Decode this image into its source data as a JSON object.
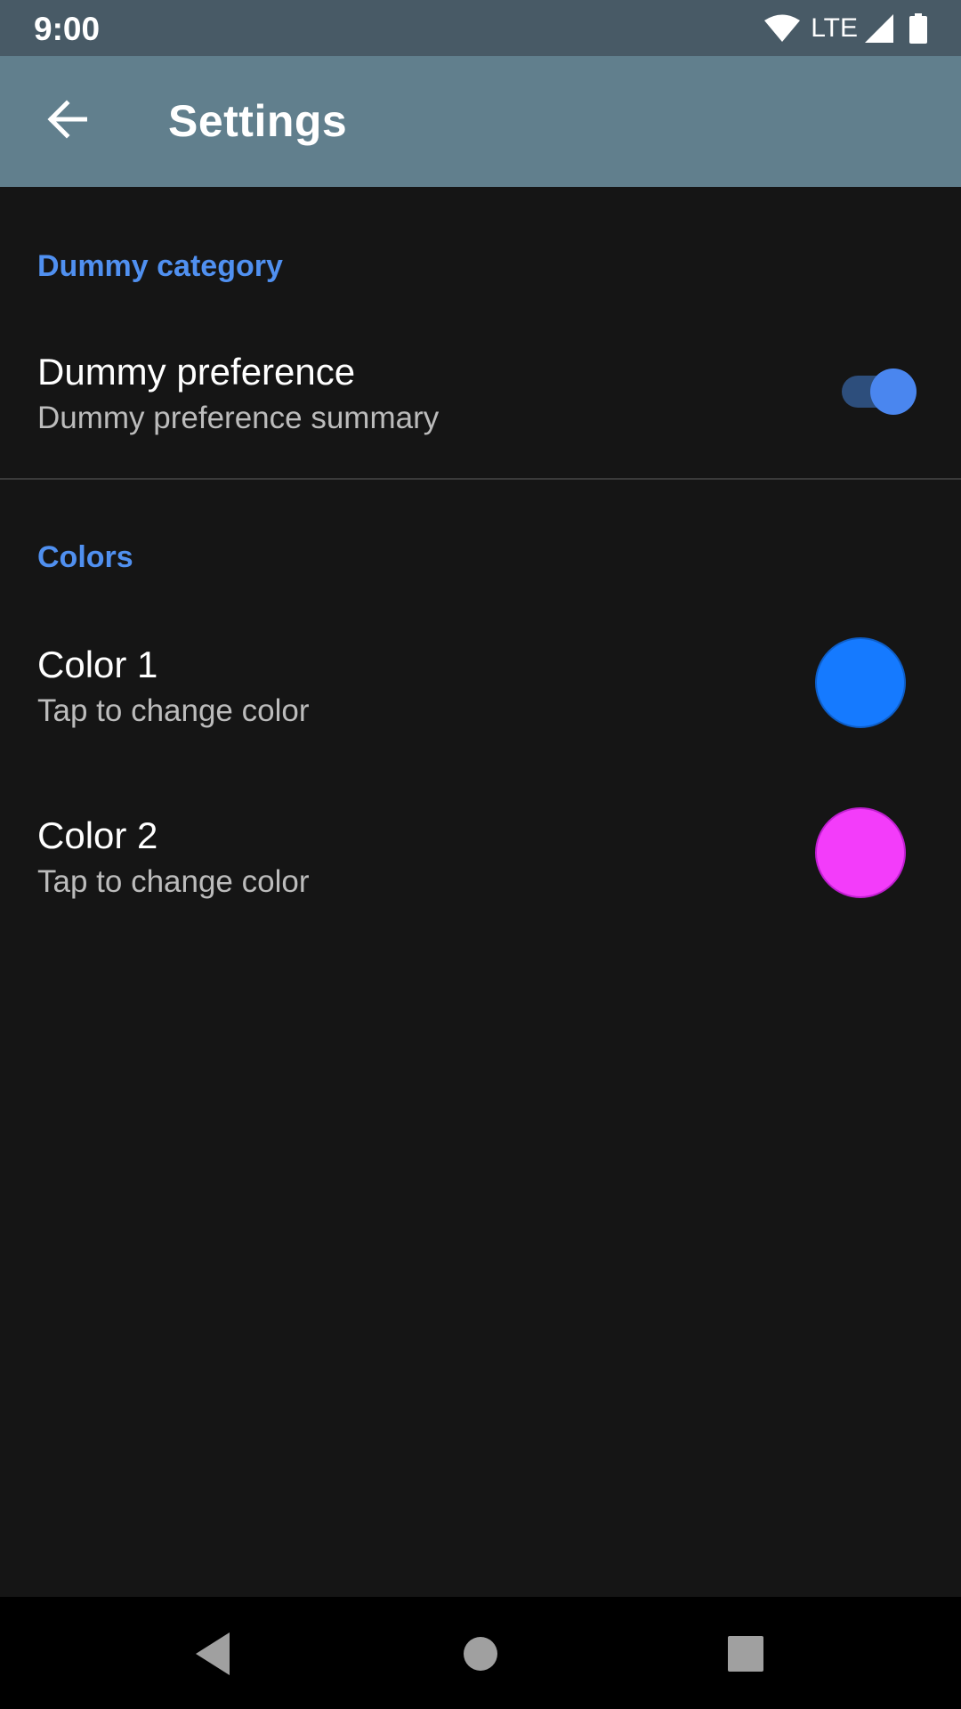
{
  "status_bar": {
    "time": "9:00",
    "network": "LTE",
    "icons": [
      "wifi-icon",
      "signal-icon",
      "battery-icon"
    ]
  },
  "app_bar": {
    "title": "Settings",
    "back_icon": "arrow-back-icon"
  },
  "categories": [
    {
      "title": "Dummy category",
      "preferences": [
        {
          "title": "Dummy preference",
          "summary": "Dummy preference summary",
          "widget": "switch",
          "checked": true
        }
      ]
    },
    {
      "title": "Colors",
      "preferences": [
        {
          "title": "Color 1",
          "summary": "Tap to change color",
          "widget": "color-swatch",
          "color": "#157aff"
        },
        {
          "title": "Color 2",
          "summary": "Tap to change color",
          "widget": "color-swatch",
          "color": "#f33cfa"
        }
      ]
    }
  ],
  "theme": {
    "accent": "#5090f0",
    "app_bar": "#617f8d",
    "status_bar": "#485a66",
    "background": "#151515"
  },
  "nav_bar": {
    "icons": [
      "nav-back-icon",
      "nav-home-icon",
      "nav-recents-icon"
    ]
  }
}
